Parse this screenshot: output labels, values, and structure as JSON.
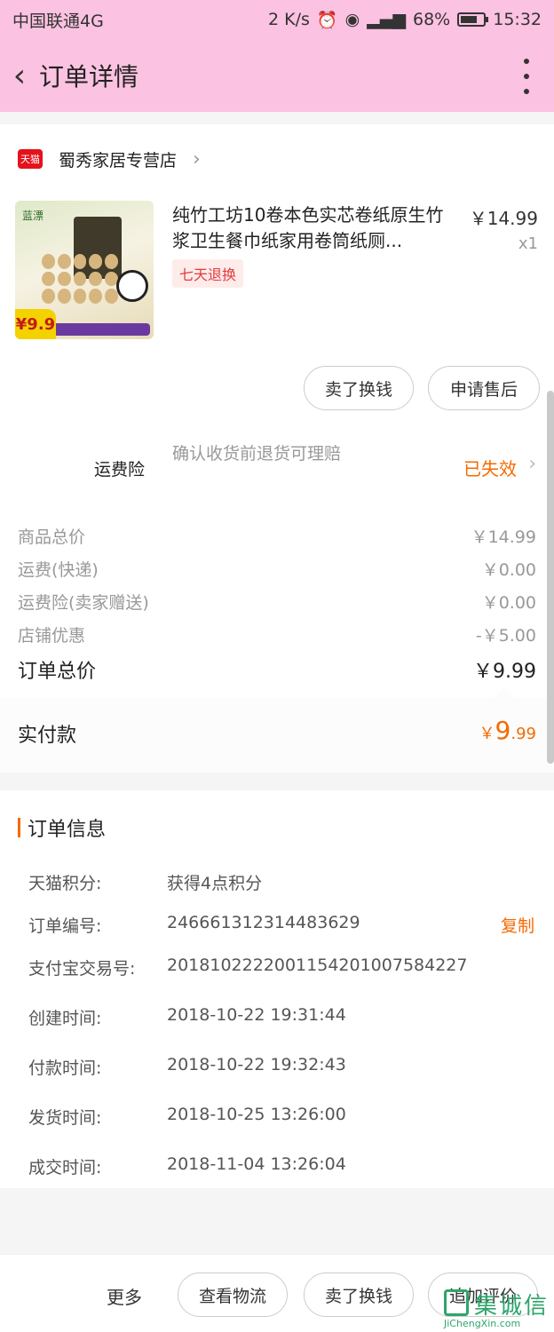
{
  "status_bar": {
    "carrier": "中国联通4G",
    "speed": "2 K/s",
    "battery": "68%",
    "time": "15:32"
  },
  "header": {
    "title": "订单详情"
  },
  "store": {
    "badge": "天猫",
    "name": "蜀秀家居专营店"
  },
  "product": {
    "title": "纯竹工坊10卷本色实芯卷纸原生竹浆卫生餐巾纸家用卷筒纸厕...",
    "price": "￥14.99",
    "quantity": "x1",
    "tag": "七天退换",
    "image_price": "¥9.9",
    "image_brand": "蓝漂"
  },
  "actions": {
    "sell_for_cash": "卖了换钱",
    "after_sales": "申请售后"
  },
  "shipping_insurance": {
    "label": "运费险",
    "desc": "确认收货前退货可理赔",
    "status": "已失效"
  },
  "price_rows": [
    {
      "label": "商品总价",
      "value": "￥14.99"
    },
    {
      "label": "运费(快递)",
      "value": "￥0.00"
    },
    {
      "label": "运费险(卖家赠送)",
      "value": "￥0.00"
    },
    {
      "label": "店铺优惠",
      "value": "-￥5.00"
    }
  ],
  "order_total": {
    "label": "订单总价",
    "value": "￥9.99"
  },
  "actual_payment": {
    "label": "实付款",
    "currency": "￥",
    "integer": "9",
    "decimal": ".99"
  },
  "order_info": {
    "title": "订单信息",
    "copy_label": "复制",
    "items": [
      {
        "key": "天猫积分:",
        "value": "获得4点积分"
      },
      {
        "key": "订单编号:",
        "value": "246661312314483629"
      },
      {
        "key": "支付宝交易号:",
        "value": "2018102222001154201007584227"
      },
      {
        "key": "创建时间:",
        "value": "2018-10-22 19:31:44"
      },
      {
        "key": "付款时间:",
        "value": "2018-10-22 19:32:43"
      },
      {
        "key": "发货时间:",
        "value": "2018-10-25 13:26:00"
      },
      {
        "key": "成交时间:",
        "value": "2018-11-04 13:26:04"
      }
    ]
  },
  "bottom_bar": {
    "more": "更多",
    "logistics": "查看物流",
    "sell_for_cash": "卖了换钱",
    "add_review": "追加评价"
  },
  "watermark": {
    "text": "集诚信",
    "url": "JiChengXin.com"
  },
  "colors": {
    "header_bg": "#fbc2e1",
    "accent": "#f56a00",
    "tmall_red": "#e5121c"
  }
}
